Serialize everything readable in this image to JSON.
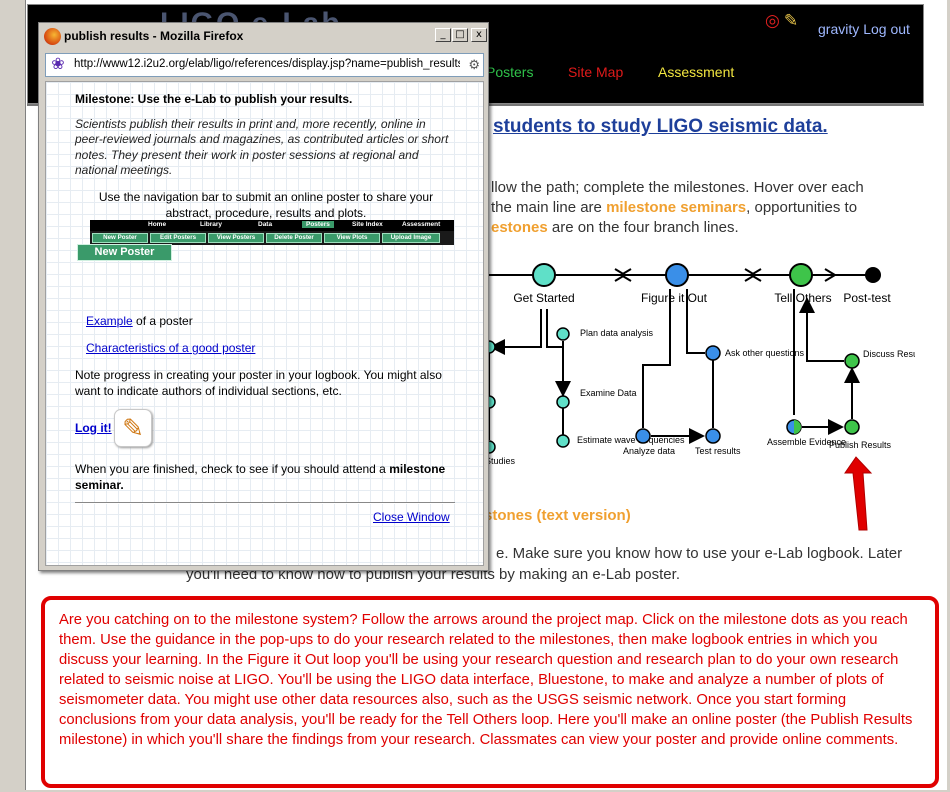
{
  "site": {
    "logo_text": "LIGO e-Lab",
    "user_links": [
      "gravity",
      "Log out"
    ],
    "nav": [
      "Posters",
      "Site Map",
      "Assessment"
    ],
    "page_heading": "students to study LIGO seismic data.",
    "intro_lines": [
      "llow the path; complete the milestones. Hover over each",
      "the main line are",
      "milestone seminars",
      ", opportunities to",
      "estones",
      " are on the four branch lines."
    ],
    "milestone_text_link": "stones (text version)",
    "logbook_line_1": "e. Make sure you know how to use your e-Lab logbook. Later",
    "logbook_line_2": "you'll need to know how to publish your results by making an e-Lab poster."
  },
  "project_map": {
    "stages": [
      "Get Started",
      "Figure it Out",
      "Tell Others",
      "Post-test"
    ],
    "branch_labels": {
      "plan": "Plan data analysis",
      "examine": "Examine Data",
      "estimate": "Estimate wave frequencies",
      "studies": "Studies",
      "ask": "Ask other questions",
      "analyze": "Analyze data",
      "test": "Test results",
      "assemble": "Assemble Evidence",
      "publish": "Publish Results",
      "discuss": "Discuss Results"
    },
    "colors": {
      "teal": "#5fe0c8",
      "blue": "#3a8fe8",
      "green": "#3ec44a",
      "black": "#000000",
      "arrow_red": "#e00000"
    }
  },
  "popup": {
    "title": "publish results - Mozilla Firefox",
    "url": "http://www12.i2u2.org/elab/ligo/references/display.jsp?name=publish_results",
    "window_buttons": [
      "_",
      "□",
      "x"
    ],
    "heading": "Milestone: Use the e-Lab to publish your results.",
    "description": "Scientists publish their results in print and, more recently, online in peer-reviewed journals and magazines, as contributed articles or short notes. They present their work in poster sessions at regional and national meetings.",
    "nav_instructions": "Use the navigation bar to submit an online poster to share your abstract, procedure, results and plots.",
    "navbar_top": [
      "Home",
      "Library",
      "Data",
      "Posters",
      "Site Index",
      "Assessment"
    ],
    "navbar_sub": [
      "New Poster",
      "Edit Posters",
      "View Posters",
      "Delete Poster",
      "View Plots",
      "Upload Image"
    ],
    "new_poster_label": "New Poster",
    "example_link": "Example",
    "example_suffix": " of a poster",
    "characteristics_link": "Characteristics of a good poster",
    "progress_note": "Note progress in creating your poster in your logbook. You might also want to indicate authors of individual sections, etc.",
    "logit_link": "Log it!",
    "finished_prefix": "When you are finished, check to see if you should attend a ",
    "finished_bold": "milestone seminar.",
    "close_window": "Close Window"
  },
  "note": {
    "text": "Are you catching on to the milestone system?  Follow the arrows around the project map.  Click on the milestone dots as you reach them.  Use the guidance in the pop-ups to do your research related to the milestones, then make logbook entries in which you discuss your learning.  In the Figure it Out loop you'll be using your research question and research plan to do your own research related to seismic noise at LIGO.  You'll be using the LIGO data interface, Bluestone, to make and analyze a number of plots of seismometer data.  You might use other data resources also, such as the USGS seismic network.  Once you start forming conclusions from your data analysis, you'll be ready for the Tell Others loop.  Here you'll make an online poster (the Publish Results milestone) in which you'll share the findings from your research.  Classmates can view your poster and provide online comments."
  }
}
